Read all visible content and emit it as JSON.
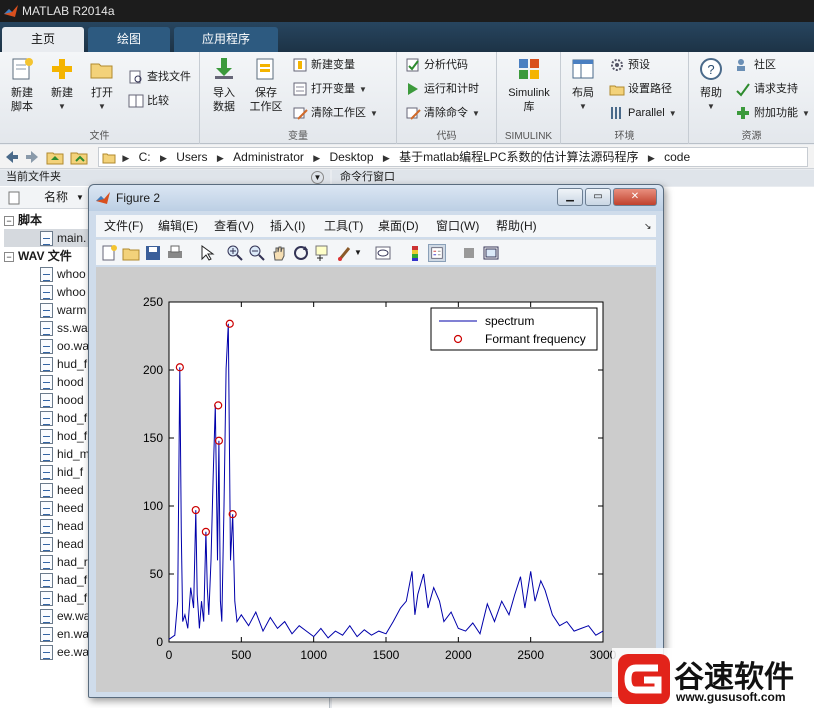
{
  "app": {
    "title": "MATLAB R2014a"
  },
  "tabs": [
    {
      "label": "主页",
      "active": true
    },
    {
      "label": "绘图",
      "active": false
    },
    {
      "label": "应用程序",
      "active": false
    }
  ],
  "ribbon": {
    "file_group": {
      "label": "文件",
      "new_script": "新建\n脚本",
      "new": "新建",
      "open": "打开",
      "find_files": "查找文件",
      "compare": "比较"
    },
    "variable_group": {
      "label": "变量",
      "import_data": "导入\n数据",
      "save_workspace": "保存\n工作区",
      "new_variable": "新建变量",
      "open_variable": "打开变量",
      "clear_workspace": "清除工作区"
    },
    "code_group": {
      "label": "代码",
      "analyze_code": "分析代码",
      "run_and_time": "运行和计时",
      "clear_commands": "清除命令"
    },
    "simulink_group": {
      "label": "SIMULINK",
      "simulink_library": "Simulink\n库"
    },
    "environment_group": {
      "label": "环境",
      "layout": "布局",
      "preferences": "预设",
      "set_path": "设置路径",
      "parallel": "Parallel"
    },
    "resources_group": {
      "label": "资源",
      "help": "帮助",
      "community": "社区",
      "request_support": "请求支持",
      "add_ons": "附加功能"
    }
  },
  "address": {
    "crumbs": [
      "C:",
      "Users",
      "Administrator",
      "Desktop",
      "基于matlab编程LPC系数的估计算法源码程序",
      "code"
    ]
  },
  "file_panel": {
    "title": "当前文件夹",
    "column_name": "名称",
    "scripts_section": "脚本",
    "wav_section": "WAV 文件",
    "script_files": [
      "main."
    ],
    "wav_files": [
      "whoo",
      "whoo",
      "warm",
      "ss.wa",
      "oo.wa",
      "hud_f",
      "hood",
      "hood",
      "hod_f",
      "hod_f",
      "hid_m",
      "hid_f",
      "heed",
      "heed",
      "head",
      "head",
      "had_r",
      "had_f",
      "had_f",
      "ew.wa",
      "en.wa",
      "ee.wa"
    ]
  },
  "command_window": {
    "title": "命令行窗口"
  },
  "figure": {
    "title": "Figure 2",
    "menu": [
      "文件(F)",
      "编辑(E)",
      "查看(V)",
      "插入(I)",
      "工具(T)",
      "桌面(D)",
      "窗口(W)",
      "帮助(H)"
    ],
    "toolbar_icons": [
      "new-figure-icon",
      "open-file-icon",
      "save-icon",
      "print-icon",
      "select-arrow-icon",
      "zoom-in-icon",
      "zoom-out-icon",
      "pan-hand-icon",
      "rotate-3d-icon",
      "data-cursor-icon",
      "brush-icon",
      "link-plot-icon",
      "colorbar-icon",
      "legend-icon",
      "hide-plot-tools-icon",
      "show-plot-tools-icon"
    ]
  },
  "chart_data": {
    "type": "line",
    "xlim": [
      0,
      3000
    ],
    "ylim": [
      0,
      250
    ],
    "xticks": [
      0,
      500,
      1000,
      1500,
      2000,
      2500,
      3000
    ],
    "yticks": [
      0,
      50,
      100,
      150,
      200,
      250
    ],
    "grid": false,
    "legend_position": "top-right",
    "series": [
      {
        "name": "spectrum",
        "style": "line",
        "color": "#0000aa",
        "x": [
          0,
          40,
          60,
          75,
          85,
          95,
          110,
          130,
          150,
          170,
          185,
          195,
          210,
          225,
          240,
          255,
          265,
          275,
          290,
          305,
          320,
          335,
          345,
          355,
          365,
          380,
          395,
          410,
          425,
          440,
          455,
          470,
          500,
          550,
          600,
          650,
          700,
          750,
          800,
          850,
          900,
          950,
          1000,
          1050,
          1100,
          1150,
          1200,
          1250,
          1300,
          1350,
          1400,
          1450,
          1500,
          1550,
          1600,
          1640,
          1680,
          1700,
          1720,
          1760,
          1790,
          1830,
          1870,
          1900,
          1950,
          2000,
          2050,
          2100,
          2150,
          2200,
          2250,
          2300,
          2350,
          2390,
          2430,
          2460,
          2500,
          2530,
          2570,
          2600,
          2650,
          2700,
          2750,
          2800,
          2850,
          2900,
          2950,
          3000
        ],
        "y": [
          2,
          5,
          30,
          202,
          80,
          15,
          20,
          10,
          40,
          25,
          97,
          35,
          10,
          30,
          15,
          81,
          40,
          20,
          60,
          120,
          174,
          60,
          148,
          30,
          15,
          100,
          201,
          234,
          60,
          94,
          30,
          15,
          20,
          12,
          22,
          8,
          18,
          10,
          15,
          6,
          12,
          8,
          4,
          10,
          3,
          8,
          5,
          12,
          4,
          9,
          5,
          8,
          6,
          15,
          25,
          30,
          52,
          20,
          35,
          50,
          25,
          40,
          30,
          15,
          22,
          10,
          8,
          14,
          6,
          28,
          15,
          30,
          20,
          35,
          48,
          25,
          52,
          30,
          45,
          38,
          20,
          12,
          15,
          8,
          10,
          12,
          5,
          8
        ]
      },
      {
        "name": "Formant frequency",
        "style": "marker",
        "marker": "circle",
        "color": "#cc0000",
        "x": [
          75,
          185,
          255,
          340,
          345,
          420,
          440
        ],
        "y": [
          202,
          97,
          81,
          174,
          148,
          234,
          94
        ]
      }
    ]
  },
  "watermark": {
    "brand_text": "谷速软件",
    "url": "www.gususoft.com"
  },
  "colors": {
    "titlebar": "#1c1c1c",
    "tabstrip": "#1d3346",
    "spectrum_line": "#0000aa",
    "formant_marker": "#cc0000",
    "watermark_red": "#e2231a"
  }
}
